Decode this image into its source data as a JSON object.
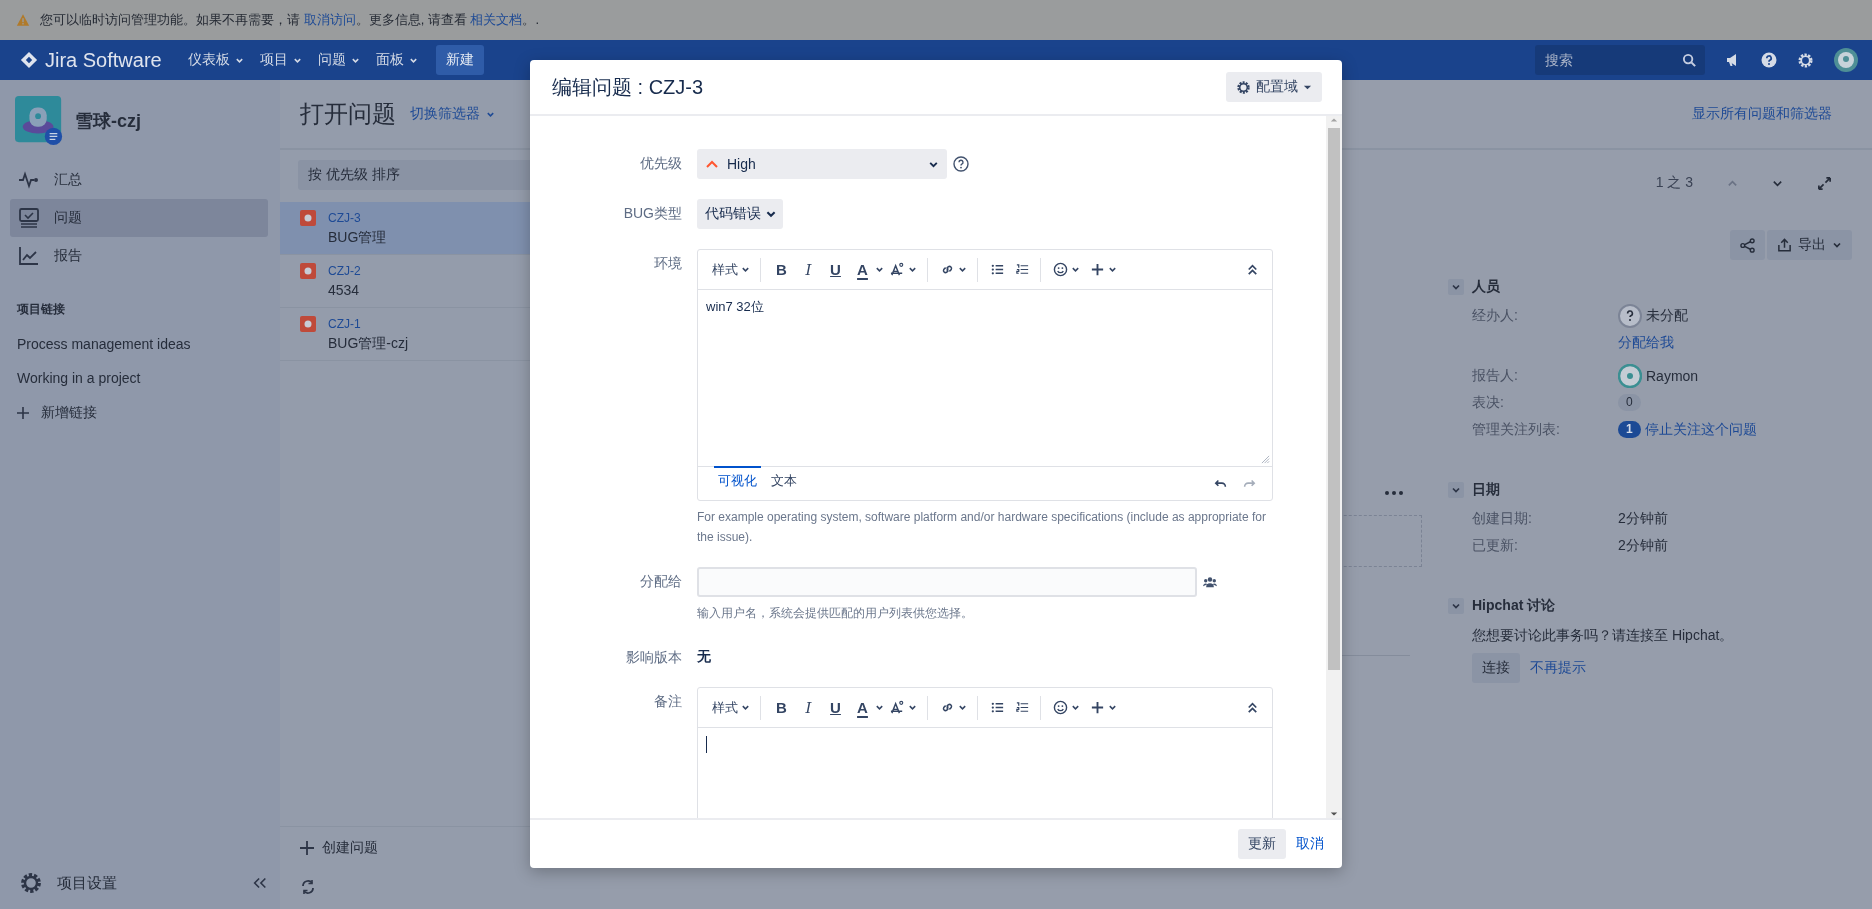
{
  "banner": {
    "segments": [
      {
        "kind": "text",
        "text": "您可以临时访问管理功能。如果不再需要，请 "
      },
      {
        "kind": "link",
        "text": "取消访问"
      },
      {
        "kind": "text",
        "text": "。更多信息, 请查看 "
      },
      {
        "kind": "link",
        "text": "相关文档"
      },
      {
        "kind": "text",
        "text": "。."
      }
    ]
  },
  "navbar": {
    "logo": "Jira Software",
    "menus": [
      {
        "label": "仪表板"
      },
      {
        "label": "项目"
      },
      {
        "label": "问题"
      },
      {
        "label": "面板"
      }
    ],
    "create_button": "新建",
    "search": {
      "placeholder": "搜索"
    }
  },
  "sidebar": {
    "project_name": "雪球-czj",
    "items": [
      {
        "label": "汇总",
        "kind": "pulse",
        "selected": false
      },
      {
        "label": "问题",
        "kind": "issues",
        "selected": true
      },
      {
        "label": "报告",
        "kind": "chart",
        "selected": false
      }
    ],
    "links_heading": "项目链接",
    "links": [
      "Process management ideas",
      "Working in a project"
    ],
    "add_link": "新增链接",
    "settings": "项目设置"
  },
  "issue_list": {
    "title": "打开问题",
    "filter_switch": "切换筛选器",
    "sort": "按 优先级 排序",
    "issues": [
      {
        "key": "CZJ-3",
        "summary": "BUG管理",
        "selected": true
      },
      {
        "key": "CZJ-2",
        "summary": "4534",
        "selected": false
      },
      {
        "key": "CZJ-1",
        "summary": "BUG管理-czj",
        "selected": false
      }
    ],
    "create": "创建问题"
  },
  "issue_view": {
    "all_issues_link": "显示所有问题和筛选器",
    "pager": "1 之 3",
    "export": "导出",
    "people": {
      "heading": "人员",
      "assignee_label": "经办人:",
      "assignee": "未分配",
      "assign_to_me": "分配给我",
      "reporter_label": "报告人:",
      "reporter": "Raymon",
      "votes_label": "表决:",
      "votes": "0",
      "watchers_label": "管理关注列表:",
      "watchers": "1",
      "unwatch": "停止关注这个问题"
    },
    "dates": {
      "heading": "日期",
      "rows": [
        {
          "label": "创建日期:",
          "value": "2分钟前"
        },
        {
          "label": "已更新:",
          "value": "2分钟前"
        }
      ]
    },
    "hipchat": {
      "heading": "Hipchat 讨论",
      "text": "您想要讨论此事务吗？请连接至 Hipchat。",
      "connect": "连接",
      "dismiss": "不再提示"
    }
  },
  "dialog": {
    "title": "编辑问题 : CZJ-3",
    "configure": "配置域",
    "fields": [
      {
        "kind": "select",
        "label": "优先级",
        "value": "High"
      },
      {
        "kind": "button_select",
        "label": "BUG类型",
        "value": "代码错误"
      },
      {
        "kind": "editor",
        "label": "环境",
        "style_label": "样式",
        "format_buttons": [
          "B",
          "I",
          "U",
          "A"
        ],
        "value": "win7 32位",
        "tabs": [
          {
            "label": "可视化",
            "selected": true
          },
          {
            "label": "文本",
            "selected": false
          }
        ],
        "help": "For example operating system, software platform and/or hardware specifications (include as appropriate for the issue)."
      },
      {
        "kind": "user",
        "label": "分配给",
        "help": "输入用户名，系统会提供匹配的用户列表供您选择。"
      },
      {
        "kind": "static",
        "label": "影响版本",
        "value": "无"
      },
      {
        "kind": "editor",
        "label": "备注",
        "style_label": "样式",
        "format_buttons": [
          "B",
          "I",
          "U",
          "A"
        ]
      }
    ],
    "update": "更新",
    "cancel": "取消"
  }
}
